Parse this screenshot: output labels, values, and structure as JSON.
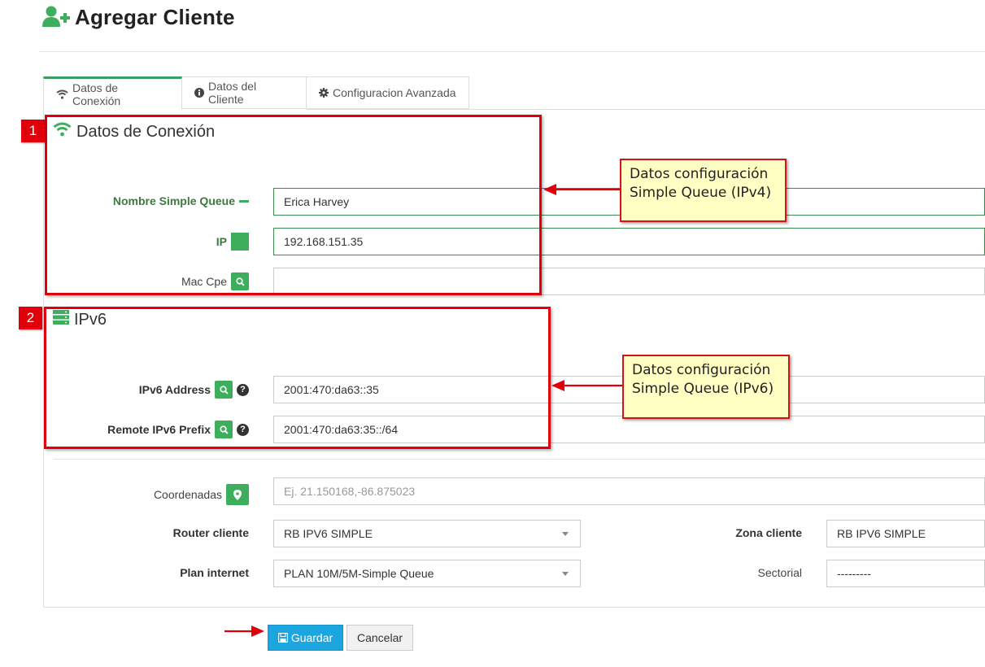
{
  "page": {
    "title": "Agregar Cliente"
  },
  "tabs": [
    {
      "label": "Datos de Conexión",
      "icon": "wifi-icon",
      "active": true
    },
    {
      "label": "Datos del Cliente",
      "icon": "info-circle-icon",
      "active": false
    },
    {
      "label": "Configuracion Avanzada",
      "icon": "gear-icon",
      "active": false
    }
  ],
  "sections": {
    "connection": {
      "title": "Datos de Conexión",
      "icon": "wifi-icon"
    },
    "ipv6": {
      "title": "IPv6",
      "icon": "server-icon"
    }
  },
  "fields": {
    "simple_queue": {
      "label": "Nombre Simple Queue",
      "value": "Erica Harvey"
    },
    "ip": {
      "label": "IP",
      "value": "192.168.151.35"
    },
    "mac_cpe": {
      "label": "Mac Cpe",
      "value": ""
    },
    "ipv6_address": {
      "label": "IPv6 Address",
      "value": "2001:470:da63::35"
    },
    "remote_ipv6_prefix": {
      "label": "Remote IPv6 Prefix",
      "value": "2001:470:da63:35::/64"
    },
    "coordenadas": {
      "label": "Coordenadas",
      "placeholder": "Ej. 21.150168,-86.875023"
    },
    "router_cliente": {
      "label": "Router cliente",
      "value": "RB IPV6 SIMPLE"
    },
    "zona_cliente": {
      "label": "Zona cliente",
      "value": "RB IPV6 SIMPLE"
    },
    "plan_internet": {
      "label": "Plan internet",
      "value": "PLAN 10M/5M-Simple Queue"
    },
    "sectorial": {
      "label": "Sectorial",
      "value": "---------"
    }
  },
  "annotations": {
    "badge1": "1",
    "badge2": "2",
    "note1": "Datos configuración Simple Queue (IPv4)",
    "note2": "Datos configuración Simple Queue (IPv6)"
  },
  "buttons": {
    "save": "Guardar",
    "cancel": "Cancelar"
  },
  "colors": {
    "accent_green": "#3dae5b",
    "primary_blue": "#1ba6e0",
    "annotation_red": "#e0000b",
    "note_yellow": "#ffffc4"
  }
}
